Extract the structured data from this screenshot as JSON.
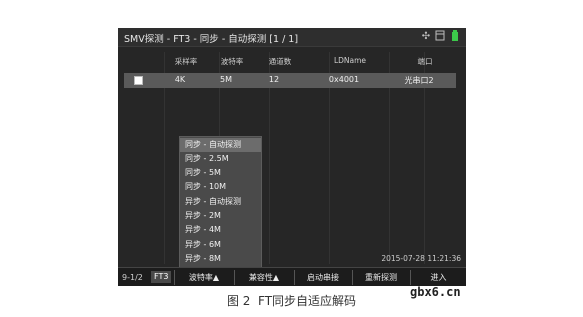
{
  "window": {
    "title": "SMV探测 - FT3 - 同步 - 自动探测 [1 / 1]"
  },
  "icons": {
    "gps": "satellite-icon",
    "storage": "storage-icon",
    "battery": "battery-icon",
    "battery_color": "#3cc84b"
  },
  "table": {
    "headers": [
      "采样率",
      "波特率",
      "通道数",
      "LDName",
      "端口"
    ],
    "rows": [
      {
        "checked": false,
        "cells": [
          "4K",
          "5M",
          "12",
          "0x4001",
          "光串口2"
        ]
      }
    ]
  },
  "dropdown": {
    "items": [
      "同步 - 自动探测",
      "同步 - 2.5M",
      "同步 - 5M",
      "同步 - 10M",
      "异步 - 自动探测",
      "异步 - 2M",
      "异步 - 4M",
      "异步 - 6M",
      "异步 - 8M"
    ],
    "selected_index": 0
  },
  "timestamp": "2015-07-28 11:21:36",
  "bottombar": {
    "page": "9-1/2",
    "badge": "FT3",
    "buttons": [
      "波特率▲",
      "兼容性▲",
      "启动串接",
      "重新探测",
      "进入"
    ]
  },
  "caption": "图 2  FT同步自适应解码",
  "watermark": "gbx6.cn"
}
